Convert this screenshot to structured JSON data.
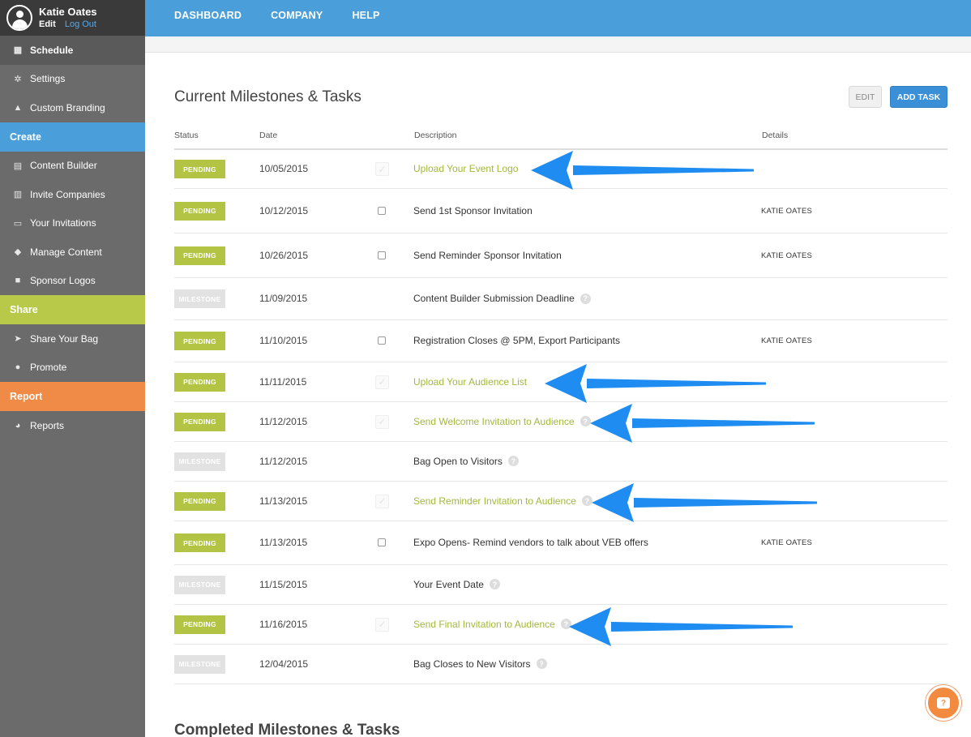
{
  "user": {
    "name": "Katie Oates",
    "edit_label": "Edit",
    "logout_label": "Log Out"
  },
  "sidebar": {
    "items_top": [
      {
        "label": "Schedule",
        "icon": "calendar-icon"
      },
      {
        "label": "Settings",
        "icon": "gear-icon"
      },
      {
        "label": "Custom Branding",
        "icon": "flask-icon"
      }
    ],
    "create_label": "Create",
    "create_items": [
      {
        "label": "Content Builder",
        "icon": "layout-icon"
      },
      {
        "label": "Invite Companies",
        "icon": "building-icon"
      },
      {
        "label": "Your Invitations",
        "icon": "inbox-icon"
      },
      {
        "label": "Manage Content",
        "icon": "tag-icon"
      },
      {
        "label": "Sponsor Logos",
        "icon": "briefcase-icon"
      }
    ],
    "share_label": "Share",
    "share_items": [
      {
        "label": "Share Your Bag",
        "icon": "paper-plane-icon"
      },
      {
        "label": "Promote",
        "icon": "globe-icon"
      }
    ],
    "report_label": "Report",
    "report_items": [
      {
        "label": "Reports",
        "icon": "pie-chart-icon"
      }
    ]
  },
  "topnav": {
    "dashboard": "DASHBOARD",
    "company": "COMPANY",
    "help": "HELP"
  },
  "main": {
    "title": "Current Milestones & Tasks",
    "edit_label": "EDIT",
    "add_task_label": "ADD TASK",
    "columns": {
      "status": "Status",
      "date": "Date",
      "description": "Description",
      "details": "Details"
    },
    "completed_title": "Completed Milestones & Tasks"
  },
  "rows": [
    {
      "status": "PENDING",
      "date": "10/05/2015",
      "check": "faded",
      "desc": "Upload Your Event Logo",
      "green": true,
      "help": false,
      "details": ""
    },
    {
      "status": "PENDING",
      "date": "10/12/2015",
      "check": "box",
      "desc": "Send 1st Sponsor Invitation",
      "green": false,
      "help": false,
      "details": "KATIE OATES"
    },
    {
      "status": "PENDING",
      "date": "10/26/2015",
      "check": "box",
      "desc": "Send Reminder Sponsor Invitation",
      "green": false,
      "help": false,
      "details": "KATIE OATES"
    },
    {
      "status": "MILESTONE",
      "date": "11/09/2015",
      "check": "none",
      "desc": "Content Builder Submission Deadline",
      "green": false,
      "help": true,
      "details": ""
    },
    {
      "status": "PENDING",
      "date": "11/10/2015",
      "check": "box",
      "desc": "Registration Closes @ 5PM, Export Participants",
      "green": false,
      "help": false,
      "details": "KATIE OATES"
    },
    {
      "status": "PENDING",
      "date": "11/11/2015",
      "check": "faded",
      "desc": "Upload Your Audience List",
      "green": true,
      "help": false,
      "details": ""
    },
    {
      "status": "PENDING",
      "date": "11/12/2015",
      "check": "faded",
      "desc": "Send Welcome Invitation to Audience",
      "green": true,
      "help": true,
      "details": ""
    },
    {
      "status": "MILESTONE",
      "date": "11/12/2015",
      "check": "none",
      "desc": "Bag Open to Visitors",
      "green": false,
      "help": true,
      "details": ""
    },
    {
      "status": "PENDING",
      "date": "11/13/2015",
      "check": "faded",
      "desc": "Send Reminder Invitation to Audience",
      "green": true,
      "help": true,
      "details": ""
    },
    {
      "status": "PENDING",
      "date": "11/13/2015",
      "check": "box",
      "desc": "Expo Opens- Remind vendors to talk about VEB offers",
      "green": false,
      "help": false,
      "details": "KATIE OATES"
    },
    {
      "status": "MILESTONE",
      "date": "11/15/2015",
      "check": "none",
      "desc": "Your Event Date",
      "green": false,
      "help": true,
      "details": ""
    },
    {
      "status": "PENDING",
      "date": "11/16/2015",
      "check": "faded",
      "desc": "Send Final Invitation to Audience",
      "green": true,
      "help": true,
      "details": ""
    },
    {
      "status": "MILESTONE",
      "date": "12/04/2015",
      "check": "none",
      "desc": "Bag Closes to New Visitors",
      "green": false,
      "help": true,
      "details": ""
    }
  ],
  "annotation_color": "#1e8cf0",
  "help_bubble_icon": "question-chat-icon"
}
